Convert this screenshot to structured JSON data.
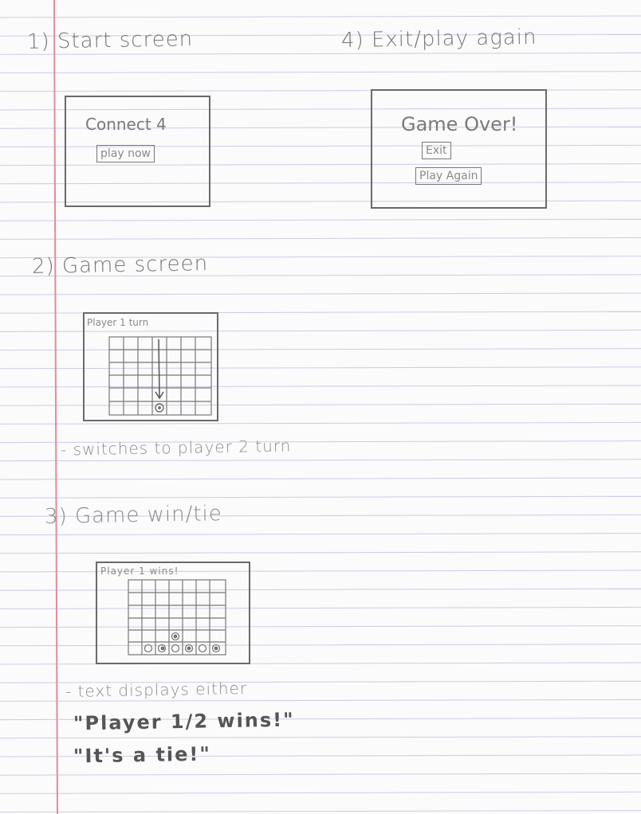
{
  "sections": {
    "start": {
      "heading": "1) Start screen",
      "title": "Connect 4",
      "button": "play now"
    },
    "exit": {
      "heading": "4) Exit/play again",
      "title": "Game Over!",
      "exit_button": "Exit",
      "again_button": "Play Again"
    },
    "game": {
      "heading": "2) Game screen",
      "turn_label": "Player 1 turn",
      "note": "- switches to player 2 turn"
    },
    "win": {
      "heading": "3) Game win/tie",
      "win_label": "Player 1 wins!",
      "note": "- text displays either",
      "option1": "\"Player 1/2 wins!\"",
      "option2": "\"It's a tie!\""
    }
  },
  "colors": {
    "rule_line": "#c9cde6",
    "margin_line": "#e58a9c",
    "pencil": "#6a6a6a"
  }
}
